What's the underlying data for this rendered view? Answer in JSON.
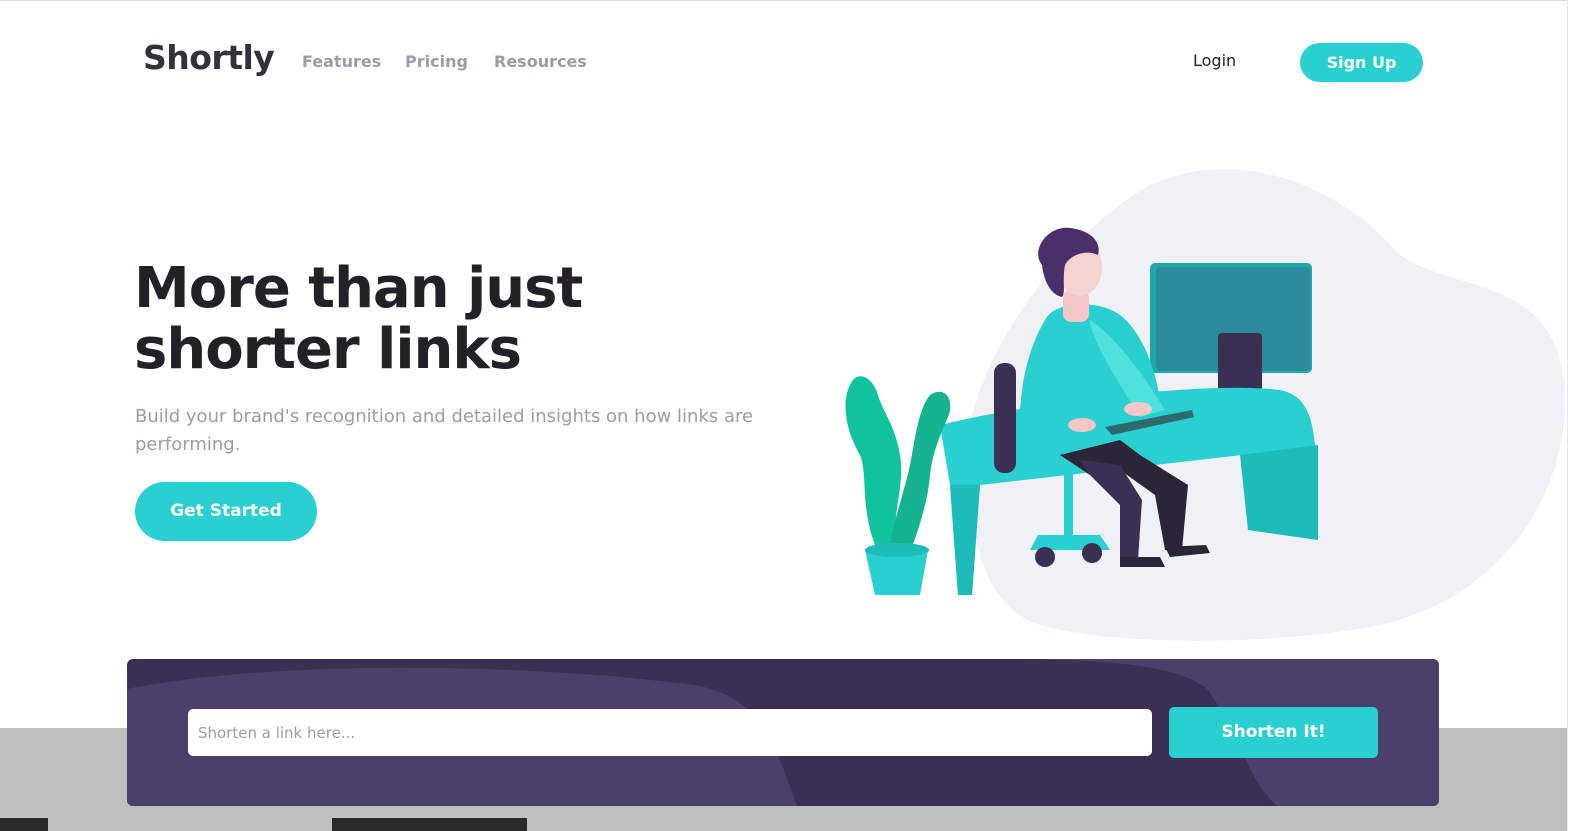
{
  "nav": {
    "logo": "Shortly",
    "links": [
      "Features",
      "Pricing",
      "Resources"
    ],
    "login": "Login",
    "signup": "Sign Up"
  },
  "hero": {
    "title_line1": "More than just",
    "title_line2": "shorter links",
    "subtitle": "Build your brand's recognition and detailed insights on how links are performing.",
    "cta": "Get Started"
  },
  "shorten": {
    "placeholder": "Shorten a link here...",
    "value": "",
    "button": "Shorten It!"
  },
  "colors": {
    "accent": "#2acfcf",
    "dark_violet": "#3b3054",
    "very_dark": "#232127",
    "gray": "#9e9aa7"
  },
  "icons": {
    "illustration": "person-working-at-desk-illustration"
  }
}
